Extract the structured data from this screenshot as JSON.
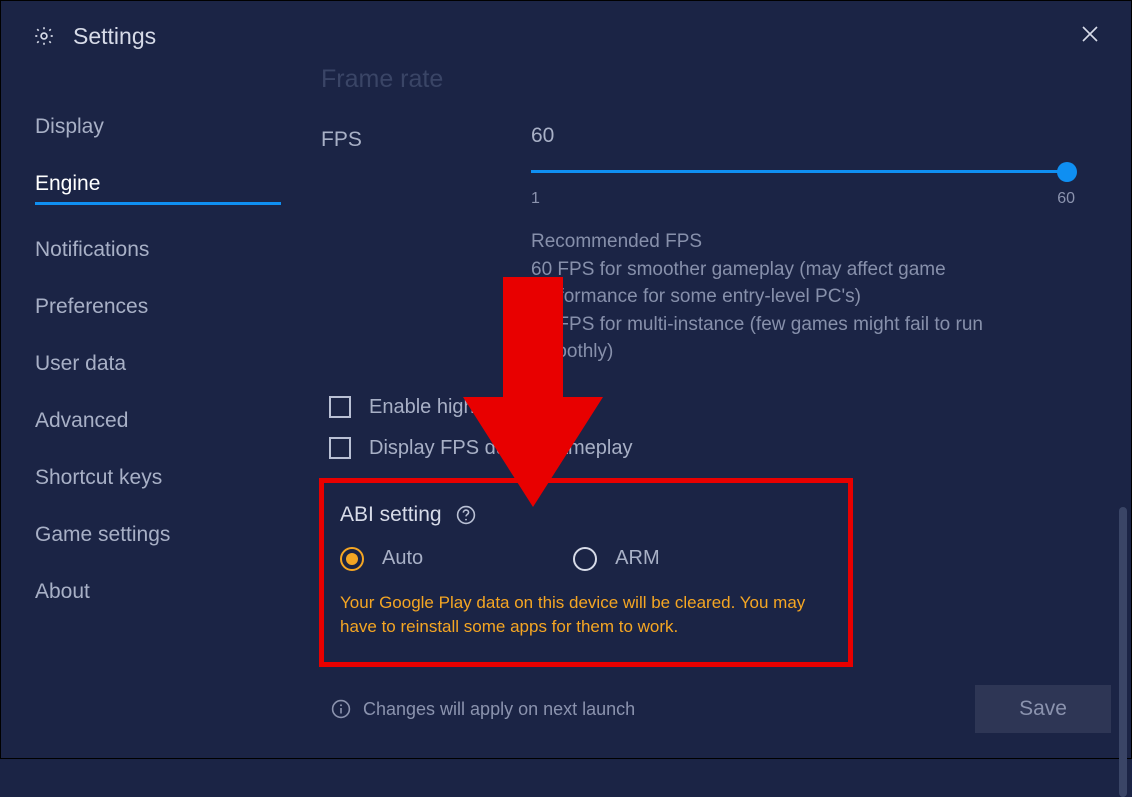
{
  "titlebar": {
    "title": "Settings"
  },
  "sidebar": {
    "items": [
      {
        "label": "Display",
        "active": false
      },
      {
        "label": "Engine",
        "active": true
      },
      {
        "label": "Notifications",
        "active": false
      },
      {
        "label": "Preferences",
        "active": false
      },
      {
        "label": "User data",
        "active": false
      },
      {
        "label": "Advanced",
        "active": false
      },
      {
        "label": "Shortcut keys",
        "active": false
      },
      {
        "label": "Game settings",
        "active": false
      },
      {
        "label": "About",
        "active": false
      }
    ]
  },
  "engine": {
    "frame_rate_heading": "Frame rate",
    "fps_label": "FPS",
    "fps_value": "60",
    "slider": {
      "min_label": "1",
      "max_label": "60",
      "min": 1,
      "max": 60,
      "value": 60
    },
    "recommended_heading": "Recommended FPS",
    "recommended_line1": "60 FPS for smoother gameplay (may affect game performance for some entry-level PC's)",
    "recommended_line2": "30 FPS for multi-instance (few games might fail to run smoothly)",
    "checkbox_high_fps": "Enable high frame rates",
    "checkbox_display_fps": "Display FPS during gameplay",
    "abi": {
      "heading": "ABI setting",
      "options": [
        {
          "label": "Auto",
          "selected": true
        },
        {
          "label": "ARM",
          "selected": false
        }
      ],
      "warning": "Your Google Play data on this device will be cleared. You may have to reinstall some apps for them to work."
    },
    "footer_info": "Changes will apply on next launch",
    "save_button": "Save"
  }
}
